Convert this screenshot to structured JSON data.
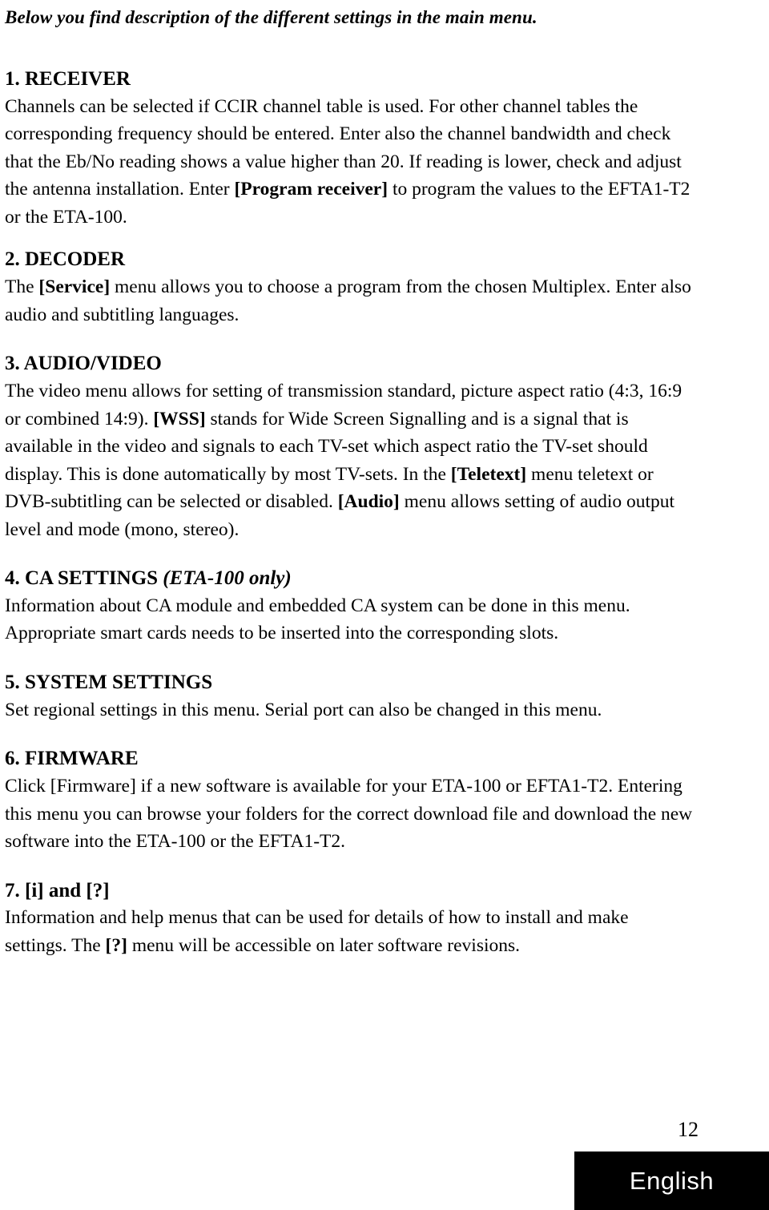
{
  "document": {
    "intro": "Below you find description of the different settings in the main menu.",
    "sections": [
      {
        "heading": "1. RECEIVER",
        "body_parts": [
          {
            "text": "Channels can be selected if CCIR channel table is used. For other channel tables the corresponding frequency should be entered. Enter also the channel bandwidth and check that the Eb/No reading shows a value higher than 20. If reading is lower, check and adjust the antenna installation. Enter ",
            "bold": false
          },
          {
            "text": "[Program receiver]",
            "bold": true
          },
          {
            "text": " to program the values to the EFTA1-T2 or the ETA-100.",
            "bold": false
          }
        ]
      },
      {
        "heading": "2. DECODER",
        "body_parts": [
          {
            "text": "The ",
            "bold": false
          },
          {
            "text": "[Service]",
            "bold": true
          },
          {
            "text": " menu allows you to choose a program from the chosen Multiplex. Enter also audio and subtitling languages.",
            "bold": false
          }
        ]
      },
      {
        "heading": "3. AUDIO/VIDEO",
        "body_parts": [
          {
            "text": "The video menu allows for setting of transmission standard, picture aspect ratio (4:3, 16:9 or combined 14:9). ",
            "bold": false
          },
          {
            "text": "[WSS]",
            "bold": true
          },
          {
            "text": " stands for Wide Screen Signalling and is a signal that is available in the video and signals to each TV-set which aspect ratio the TV-set should display. This is done automatically by most TV-sets. In the ",
            "bold": false
          },
          {
            "text": "[Teletext]",
            "bold": true
          },
          {
            "text": " menu teletext or DVB-subtitling can be selected or disabled. ",
            "bold": false
          },
          {
            "text": "[Audio]",
            "bold": true
          },
          {
            "text": " menu allows setting of audio output level and mode (mono, stereo).",
            "bold": false
          }
        ]
      },
      {
        "heading": "4. CA SETTINGS (ETA-100 only)",
        "heading_italic_part": "(ETA-100 only)",
        "body_parts": [
          {
            "text": "Information about CA module and embedded CA system can be done in this menu. Appropriate smart cards needs to be inserted into the corresponding slots.",
            "bold": false
          }
        ]
      },
      {
        "heading": "5. SYSTEM SETTINGS",
        "body_parts": [
          {
            "text": "Set regional settings in this menu. Serial port can also be changed in this menu.",
            "bold": false
          }
        ]
      },
      {
        "heading": "6. FIRMWARE",
        "body_parts": [
          {
            "text": "Click [Firmware] if a new software is available for your ETA-100 or EFTA1-T2. Entering this menu you can browse your folders for the correct download file and download the new software into the ETA-100 or the EFTA1-T2.",
            "bold": false
          }
        ]
      },
      {
        "heading": "7. [i] and [?]",
        "body_parts": [
          {
            "text": "Information and help menus that can be used for details of how to install and make settings. The ",
            "bold": false
          },
          {
            "text": "[?]",
            "bold": true
          },
          {
            "text": " menu will be accessible on later software revisions.",
            "bold": false
          }
        ]
      }
    ],
    "page_number": "12",
    "language_label": "English"
  }
}
